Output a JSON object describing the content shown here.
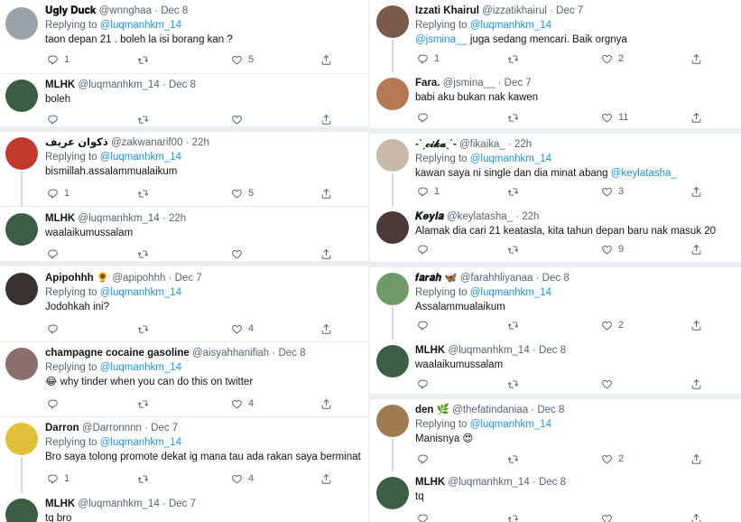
{
  "left": [
    {
      "name": "𝐔𝐠𝐥𝐲 𝐃𝐮𝐜𝐤",
      "handle": "@wnnghaa",
      "date": "Dec 8",
      "replying": "Replying to",
      "reply_to": "@luqmanhkm_14",
      "text": "taon depan 21 . boleh la isi borang kan ?",
      "reply_count": "1",
      "like_count": "5",
      "avatar_color": "#9aa3a8"
    },
    {
      "name": "MLHK",
      "handle": "@luqmanhkm_14",
      "date": "Dec 8",
      "text": "boleh",
      "reply_count": "",
      "like_count": "",
      "avatar_color": "#3b5e45"
    },
    {
      "name": "ذكوان عريف",
      "handle": "@zakwanarif00",
      "date": "22h",
      "replying": "Replying to",
      "reply_to": "@luqmanhkm_14",
      "text": "bismillah.assalammualaikum",
      "reply_count": "1",
      "like_count": "5",
      "avatar_color": "#c23a2a"
    },
    {
      "name": "MLHK",
      "handle": "@luqmanhkm_14",
      "date": "22h",
      "text": "waalaikumussalam",
      "reply_count": "",
      "like_count": "",
      "avatar_color": "#3b5e45"
    },
    {
      "name": "Apipohhh 🌻",
      "handle": "@apipohhh",
      "date": "Dec 7",
      "replying": "Replying to",
      "reply_to": "@luqmanhkm_14",
      "text": "Jodohkah ini?",
      "reply_count": "",
      "like_count": "4",
      "avatar_color": "#3a3030"
    },
    {
      "name": "champagne cocaine gasoline",
      "handle": "@aisyahhanifiah",
      "date": "Dec 8",
      "replying": "Replying to",
      "reply_to": "@luqmanhkm_14",
      "text": "why tinder when you can do this on twitter",
      "emoji": "😂",
      "reply_count": "",
      "like_count": "4",
      "avatar_color": "#8a6f6a"
    },
    {
      "name": "Darron",
      "handle": "@Darronnnn",
      "date": "Dec 7",
      "replying": "Replying to",
      "reply_to": "@luqmanhkm_14",
      "text": "Bro saya tolong promote dekat ig mana tau ada rakan saya berminat",
      "reply_count": "1",
      "like_count": "4",
      "avatar_color": "#e2c13a"
    },
    {
      "name": "MLHK",
      "handle": "@luqmanhkm_14",
      "date": "Dec 7",
      "text": "tq bro",
      "reply_count": "",
      "like_count": "",
      "avatar_color": "#3b5e45"
    }
  ],
  "right": [
    {
      "name": "Izzati Khairul",
      "handle": "@izzatikhairul",
      "date": "Dec 7",
      "replying": "Replying to",
      "reply_to": "@luqmanhkm_14",
      "mention": "@jsmina__",
      "text": " juga sedang mencari. Baik orgnya",
      "reply_count": "1",
      "like_count": "2",
      "avatar_color": "#7a5a4a"
    },
    {
      "name": "Fara.",
      "handle": "@jsmina__",
      "date": "Dec 7",
      "text": "babi aku bukan nak kawen",
      "reply_count": "",
      "like_count": "11",
      "avatar_color": "#b57a55"
    },
    {
      "name": "-ˋˏ𝓬𝓲𝓴𝓪ˎˊ-",
      "handle": "@fikaika_",
      "date": "22h",
      "replying": "Replying to",
      "reply_to": "@luqmanhkm_14",
      "text": "kawan saya ni single dan dia minat abang ",
      "mention_end": "@keylatasha_",
      "reply_count": "1",
      "like_count": "3",
      "avatar_color": "#c9b9a8"
    },
    {
      "name": "𝑲𝒆𝒚𝒍𝒂",
      "handle": "@keylatasha_",
      "date": "22h",
      "text": "Alamak dia cari 21 keatasla, kita tahun depan baru nak masuk 20",
      "reply_count": "",
      "like_count": "9",
      "avatar_color": "#4a3a38"
    },
    {
      "name": "𝒇𝒂𝒓𝒂𝒉 🦋",
      "handle": "@farahhliyanaa",
      "date": "Dec 8",
      "replying": "Replying to",
      "reply_to": "@luqmanhkm_14",
      "text": "Assalammualaikum",
      "reply_count": "",
      "like_count": "2",
      "avatar_color": "#6f9a6a"
    },
    {
      "name": "MLHK",
      "handle": "@luqmanhkm_14",
      "date": "Dec 8",
      "text": "waalaikumussalam",
      "reply_count": "",
      "like_count": "",
      "avatar_color": "#3b5e45"
    },
    {
      "name": "den 🌿",
      "handle": "@thefatindaniaa",
      "date": "Dec 8",
      "replying": "Replying to",
      "reply_to": "@luqmanhkm_14",
      "text": "Manisnya ",
      "emoji": "😍",
      "reply_count": "",
      "like_count": "2",
      "avatar_color": "#a07a50"
    },
    {
      "name": "MLHK",
      "handle": "@luqmanhkm_14",
      "date": "Dec 8",
      "text": "tq",
      "reply_count": "",
      "like_count": "",
      "avatar_color": "#3b5e45"
    }
  ],
  "colors": {
    "accent": "#1b95e0",
    "muted": "#536471"
  }
}
